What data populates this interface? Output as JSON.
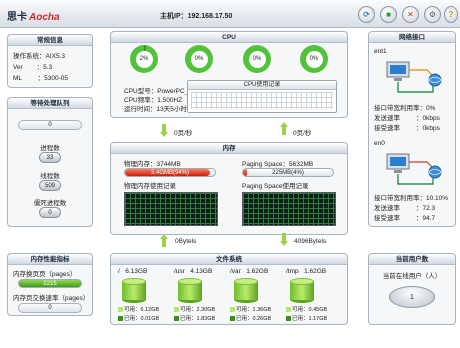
{
  "header": {
    "brand_cn": "思卡",
    "brand_en": "Aocha",
    "host_label": "主机IP：",
    "host_ip": "192.168.17.50",
    "buttons": [
      "refresh-icon",
      "network-icon",
      "close-icon",
      "settings-icon",
      "help-icon"
    ]
  },
  "basic": {
    "title": "常规信息",
    "rows": [
      {
        "label": "操作系统：",
        "value": "AIX5.3"
      },
      {
        "label": "Ver",
        "value": "：5.3"
      },
      {
        "label": "ML",
        "value": "：5300-05"
      }
    ]
  },
  "queue": {
    "title": "等待处理队列",
    "field": "0",
    "process_label": "进程数",
    "process_value": "33",
    "thread_label": "线程数",
    "thread_value": "509",
    "zombie_label": "僵死进程数",
    "zombie_value": "0"
  },
  "mem_perf": {
    "title": "内存性能指标",
    "in_label": "内存换页页（pages）",
    "in_value": "2215",
    "out_label": "内存页交换速率（pages）",
    "out_value": "0"
  },
  "cpu": {
    "title": "CPU",
    "gauges": [
      {
        "value": "2%",
        "pct": 2
      },
      {
        "value": "0%",
        "pct": 0
      },
      {
        "value": "0%",
        "pct": 0
      },
      {
        "value": "0%",
        "pct": 0
      }
    ],
    "model_label": "CPU型号：",
    "model": "PowerPC_P...",
    "freq_label": "CPU频率：",
    "freq": "1.500HZ",
    "uptime_label": "运行时间：",
    "uptime": "13天5小时...",
    "chart_title": "CPU使用记录"
  },
  "rates": {
    "top_left": "0页/秒",
    "top_right": "0页/秒",
    "bottom_left": "0Bytels",
    "bottom_right": "4096Bytels"
  },
  "memory": {
    "title": "内存",
    "phys_label": "物理内存：",
    "phys_total": "3744MB",
    "phys_used": "3.4GMB(94%)",
    "phys_pct": 94,
    "paging_label": "Paging Space：",
    "paging_total": "5632MB",
    "paging_used": "225MB(4%)",
    "paging_pct": 4,
    "phys_chart": "物理内存使用记录",
    "paging_chart": "Paging Space使用记录"
  },
  "fs": {
    "title": "文件系统",
    "free_label": "可用：",
    "used_label": "已用：",
    "items": [
      {
        "name": "/",
        "total": "6.13GB",
        "free": "6.12GB",
        "used": "0.01GB"
      },
      {
        "name": "/usr",
        "total": "4.13GB",
        "free": "2.30GB",
        "used": "1.83GB"
      },
      {
        "name": "/var",
        "total": "1.62GB",
        "free": "1.36GB",
        "used": "0.26GB"
      },
      {
        "name": "/tmp",
        "total": "1.62GB",
        "free": "0.45GB",
        "used": "1.17GB"
      }
    ]
  },
  "network": {
    "title": "网络接口",
    "interfaces": [
      {
        "name": "ent1",
        "util": "接口带宽利用率：0%",
        "send_label": "发送速率",
        "send": "0kbps",
        "recv_label": "接受速率",
        "recv": "0kbps"
      },
      {
        "name": "en0",
        "util": "接口带宽利用率：10.10%",
        "send_label": "发送速率",
        "send": "72.3",
        "recv_label": "接受速率",
        "recv": "94.7"
      }
    ]
  },
  "users": {
    "title": "当前用户数",
    "label": "当前在线用户（人）",
    "value": "1"
  }
}
